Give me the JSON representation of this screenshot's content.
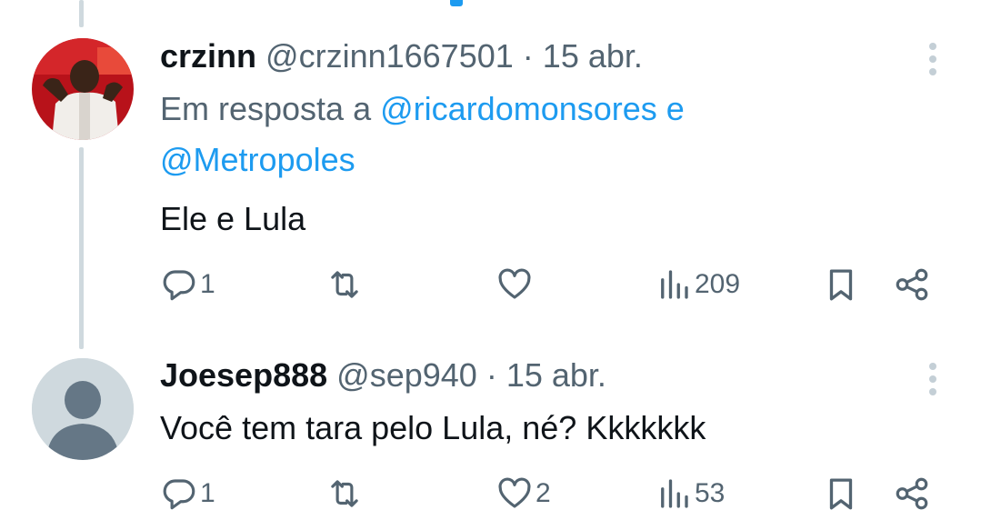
{
  "colors": {
    "link": "#1d9bf0",
    "muted": "#536471",
    "thread_line": "#cfd9de"
  },
  "tweets": [
    {
      "name": "crzinn",
      "handle": "@crzinn1667501",
      "separator": "·",
      "date": "15 abr.",
      "reply_prefix": "Em resposta a",
      "reply_user_1": "@ricardomonsores",
      "reply_conj": "e",
      "reply_user_2": "@Metropoles",
      "text": "Ele e Lula",
      "replies": "1",
      "retweets": "",
      "likes": "",
      "views": "209",
      "icons": [
        "reply-icon",
        "retweet-icon",
        "like-icon",
        "views-icon",
        "bookmark-icon",
        "share-icon",
        "more-icon"
      ]
    },
    {
      "name": "Joesep888",
      "handle": "@sep940",
      "separator": "·",
      "date": "15 abr.",
      "text": "Você tem tara pelo Lula, né? Kkkkkkk",
      "replies": "1",
      "retweets": "",
      "likes": "2",
      "views": "53",
      "icons": [
        "reply-icon",
        "retweet-icon",
        "like-icon",
        "views-icon",
        "bookmark-icon",
        "share-icon",
        "more-icon"
      ]
    }
  ]
}
